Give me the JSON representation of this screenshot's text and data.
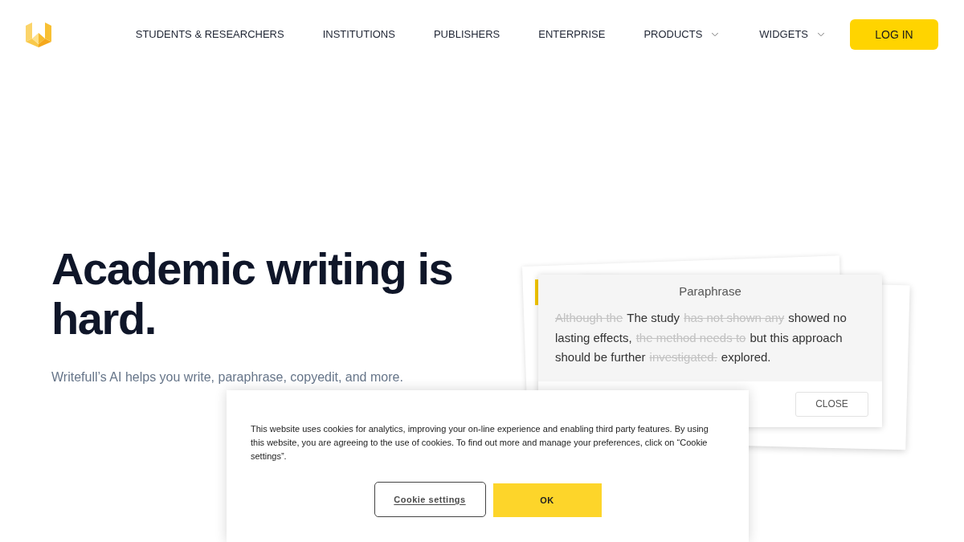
{
  "header": {
    "nav_items": [
      {
        "label": "STUDENTS & RESEARCHERS",
        "has_menu": false
      },
      {
        "label": "INSTITUTIONS",
        "has_menu": false
      },
      {
        "label": "PUBLISHERS",
        "has_menu": false
      },
      {
        "label": "ENTERPRISE",
        "has_menu": false
      },
      {
        "label": "PRODUCTS",
        "has_menu": true
      },
      {
        "label": "WIDGETS",
        "has_menu": true
      }
    ],
    "login_button": "LOG IN"
  },
  "hero": {
    "title": "Academic writing is hard.",
    "subtitle": "Writefull’s AI helps you write, paraphrase, copyedit, and more."
  },
  "paraphrase_card": {
    "title": "Paraphrase",
    "lines": [
      [
        {
          "text": "Although the",
          "deleted": true
        },
        {
          "text": "The study",
          "deleted": false
        },
        {
          "text": "has not shown any",
          "deleted": true
        },
        {
          "text": "showed no",
          "deleted": false
        }
      ],
      [
        {
          "text": "lasting effects,",
          "deleted": false
        },
        {
          "text": "the method needs to",
          "deleted": true
        },
        {
          "text": "but this approach",
          "deleted": false
        }
      ],
      [
        {
          "text": "should be further",
          "deleted": false
        },
        {
          "text": "investigated.",
          "deleted": true
        },
        {
          "text": "explored.",
          "deleted": false
        }
      ]
    ],
    "close_button": "CLOSE"
  },
  "cookie_banner": {
    "message": "This website uses cookies for analytics, improving your on-line experience and enabling third party features. By using this website, you are agreeing to the use of cookies. To find out more and manage your preferences, click on “Cookie settings”.",
    "buttons": [
      {
        "label": "Cookie settings",
        "kind": "secondary"
      },
      {
        "label": "OK",
        "kind": "primary"
      }
    ]
  }
}
